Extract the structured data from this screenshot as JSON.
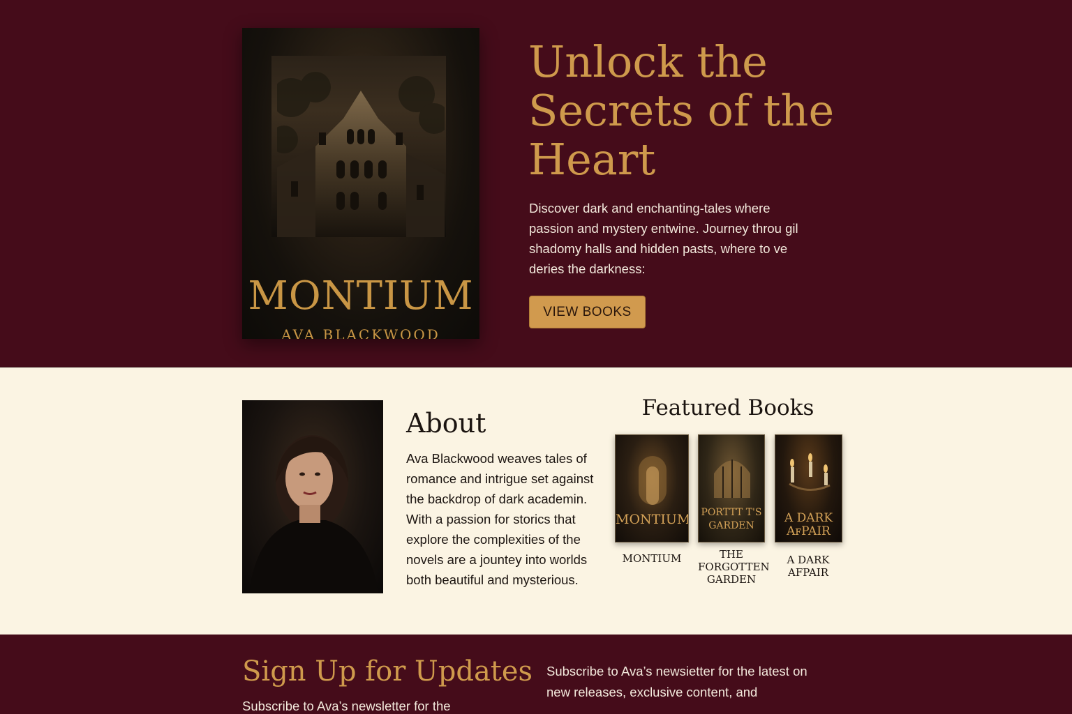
{
  "colors": {
    "burgundy": "#450c1a",
    "gold": "#cf9a4c",
    "cream": "#fbf4e3",
    "button": "#d19a4e"
  },
  "hero": {
    "cover_title": "MONTIUM",
    "cover_author": "AVA BLACKWOOD",
    "title": "Unlock the Secrets of the Heart",
    "text": "Discover dark and enchanting-tales where passion and mystery entwine. Journey throu gil shadomy halls and hidden pasts, where to ve deries the darkness:",
    "button_label": "VIEW BOOKS"
  },
  "about": {
    "title": "About",
    "text": "Ava Blackwood weaves tales of romance and intrigue set against the backdrop of dark academin. With a passion for storics that explore the complexities of the novels are a jountey into worlds both beautiful and mysterious."
  },
  "featured": {
    "title": "Featured Books",
    "books": [
      {
        "cover_title": "MONTIUM",
        "caption": "MONTIUM"
      },
      {
        "cover_title": "PORTTT T'S GARDEN",
        "caption": "THE FORGOTTEN GARDEN"
      },
      {
        "cover_title": "A DARK AꜰPAIR",
        "caption": "A DARK AFPAIR"
      }
    ]
  },
  "signup": {
    "title": "Sign Up for Updates",
    "subtitle": "Subscribe to Ava’s newsletter for the",
    "right_text": "Subscribe to Ava’s newsietter for the latest on new releases, exclusive content, and"
  }
}
